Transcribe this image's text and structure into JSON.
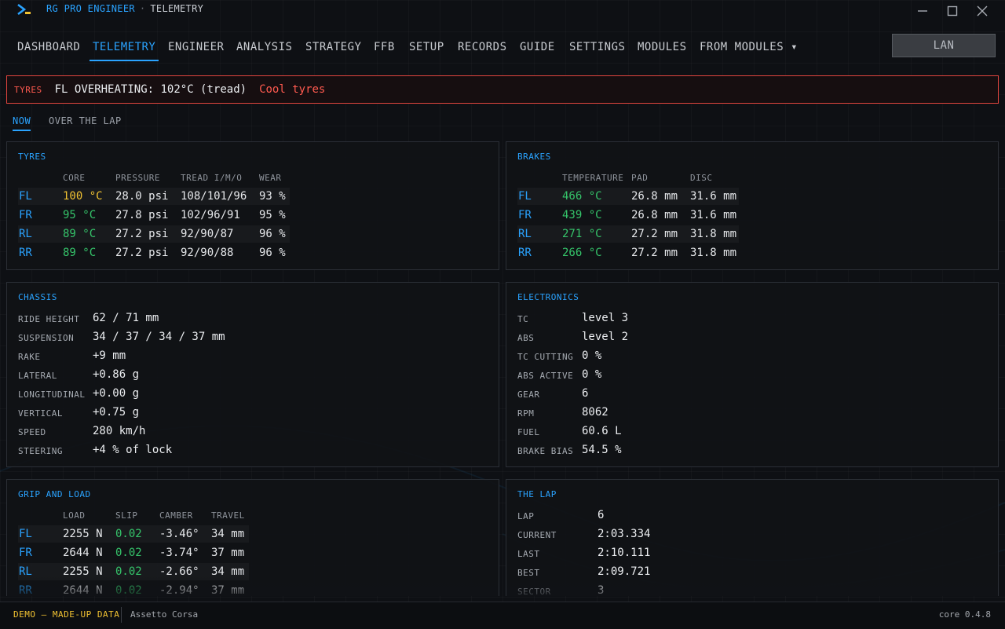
{
  "window": {
    "brand": "RG PRO ENGINEER",
    "section": "TELEMETRY",
    "separator": "·"
  },
  "nav": {
    "tabs": [
      "DASHBOARD",
      "TELEMETRY",
      "ENGINEER",
      "ANALYSIS",
      "STRATEGY",
      "FFB",
      "SETUP",
      "RECORDS",
      "GUIDE",
      "SETTINGS",
      "MODULES",
      "FROM MODULES ▾"
    ],
    "active": "TELEMETRY",
    "lan_label": "LAN"
  },
  "alert": {
    "tag": "TYRES",
    "message": "FL OVERHEATING: 102°C (tread)",
    "action": "Cool tyres"
  },
  "subtabs": {
    "now": "NOW",
    "lap": "OVER THE LAP"
  },
  "tyres": {
    "title": "TYRES",
    "headers": [
      "CORE",
      "PRESSURE",
      "TREAD I/M/O",
      "WEAR"
    ],
    "rows": [
      {
        "corner": "FL",
        "core": "100 °C",
        "pressure": "28.0 psi",
        "tread": "108/101/96",
        "wear": "93 %"
      },
      {
        "corner": "FR",
        "core": "95 °C",
        "pressure": "27.8 psi",
        "tread": "102/96/91",
        "wear": "95 %"
      },
      {
        "corner": "RL",
        "core": "89 °C",
        "pressure": "27.2 psi",
        "tread": "92/90/87",
        "wear": "96 %"
      },
      {
        "corner": "RR",
        "core": "89 °C",
        "pressure": "27.2 psi",
        "tread": "92/90/88",
        "wear": "96 %"
      }
    ]
  },
  "brakes": {
    "title": "BRAKES",
    "headers": [
      "TEMPERATURE",
      "PAD",
      "DISC"
    ],
    "rows": [
      {
        "corner": "FL",
        "temp": "466 °C",
        "pad": "26.8 mm",
        "disc": "31.6 mm"
      },
      {
        "corner": "FR",
        "temp": "439 °C",
        "pad": "26.8 mm",
        "disc": "31.6 mm"
      },
      {
        "corner": "RL",
        "temp": "271 °C",
        "pad": "27.2 mm",
        "disc": "31.8 mm"
      },
      {
        "corner": "RR",
        "temp": "266 °C",
        "pad": "27.2 mm",
        "disc": "31.8 mm"
      }
    ]
  },
  "chassis": {
    "title": "CHASSIS",
    "items": [
      {
        "label": "RIDE HEIGHT",
        "value": "62 / 71 mm"
      },
      {
        "label": "SUSPENSION",
        "value": "34 / 37 / 34 / 37 mm"
      },
      {
        "label": "RAKE",
        "value": "+9 mm"
      },
      {
        "label": "LATERAL",
        "value": "+0.86 g"
      },
      {
        "label": "LONGITUDINAL",
        "value": "+0.00 g"
      },
      {
        "label": "VERTICAL",
        "value": "+0.75 g"
      },
      {
        "label": "SPEED",
        "value": "280 km/h"
      },
      {
        "label": "STEERING",
        "value": "+4 % of lock"
      }
    ]
  },
  "electronics": {
    "title": "ELECTRONICS",
    "items": [
      {
        "label": "TC",
        "value": "level 3"
      },
      {
        "label": "ABS",
        "value": "level 2"
      },
      {
        "label": "TC CUTTING",
        "value": "0 %"
      },
      {
        "label": "ABS ACTIVE",
        "value": "0 %"
      },
      {
        "label": "GEAR",
        "value": "6"
      },
      {
        "label": "RPM",
        "value": "8062"
      },
      {
        "label": "FUEL",
        "value": "60.6 L"
      },
      {
        "label": "BRAKE BIAS",
        "value": "54.5 %"
      }
    ]
  },
  "grip": {
    "title": "GRIP AND LOAD",
    "headers": [
      "LOAD",
      "SLIP",
      "CAMBER",
      "TRAVEL"
    ],
    "rows": [
      {
        "corner": "FL",
        "load": "2255 N",
        "slip": "0.02",
        "camber": "-3.46°",
        "travel": "34 mm"
      },
      {
        "corner": "FR",
        "load": "2644 N",
        "slip": "0.02",
        "camber": "-3.74°",
        "travel": "37 mm"
      },
      {
        "corner": "RL",
        "load": "2255 N",
        "slip": "0.02",
        "camber": "-2.66°",
        "travel": "34 mm"
      },
      {
        "corner": "RR",
        "load": "2644 N",
        "slip": "0.02",
        "camber": "-2.94°",
        "travel": "37 mm"
      }
    ]
  },
  "lap": {
    "title": "THE LAP",
    "items": [
      {
        "label": "LAP",
        "value": "6"
      },
      {
        "label": "CURRENT",
        "value": "2:03.334"
      },
      {
        "label": "LAST",
        "value": "2:10.111"
      },
      {
        "label": "BEST",
        "value": "2:09.721"
      },
      {
        "label": "SECTOR",
        "value": "3"
      }
    ]
  },
  "footer": {
    "demo": "DEMO — MADE-UP DATA",
    "game": "Assetto Corsa",
    "version": "core 0.4.8"
  },
  "colors": {
    "accent": "#2aa3ff",
    "warning": "#f1c232",
    "ok": "#35c46a",
    "alert": "#e0453e"
  }
}
